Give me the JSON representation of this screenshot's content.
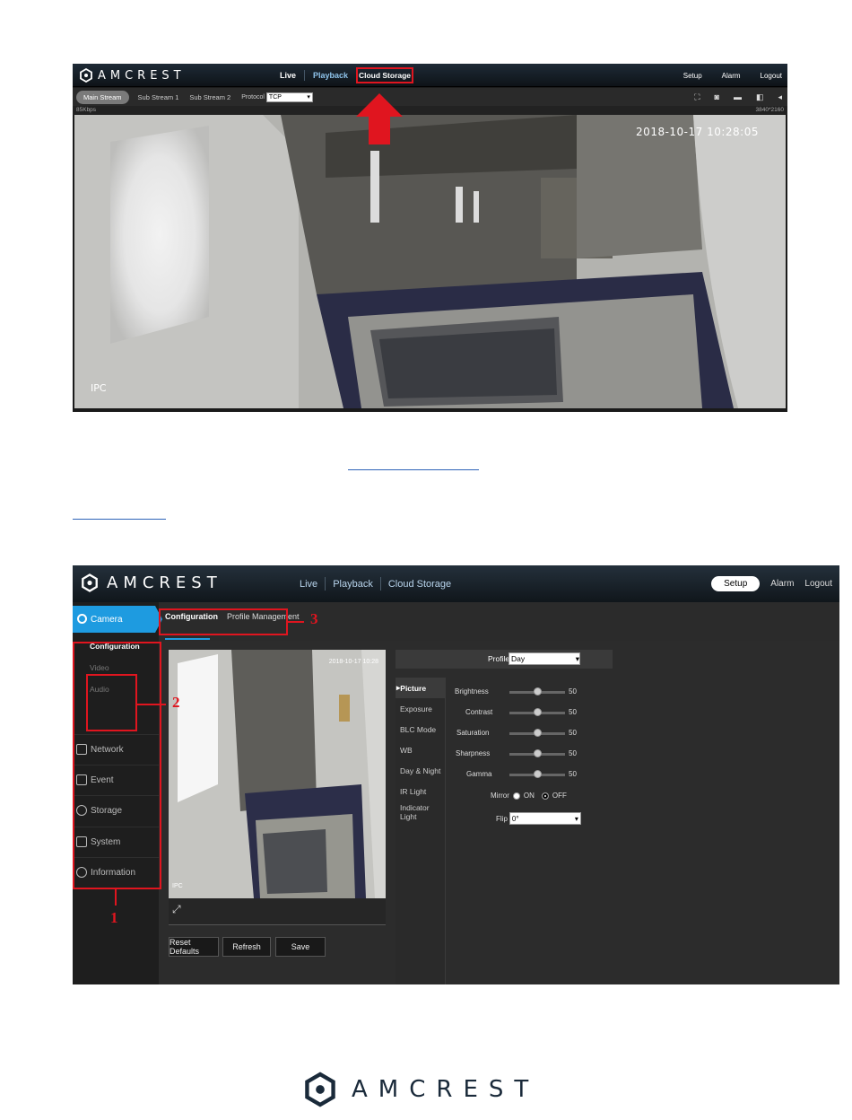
{
  "live_view": {
    "brand": "AMCREST",
    "nav": [
      "Live",
      "Playback",
      "Cloud Storage"
    ],
    "nav_right": [
      "Setup",
      "Alarm",
      "Logout"
    ],
    "streams": [
      "Main Stream",
      "Sub Stream 1",
      "Sub Stream 2"
    ],
    "protocol_label": "Protocol",
    "protocol_value": "TCP",
    "bitrate": "85Kbps",
    "resolution": "3840*2160",
    "timestamp": "2018-10-17 10:28:05",
    "overlay": "IPC"
  },
  "setup_view": {
    "brand": "AMCREST",
    "nav": [
      "Live",
      "Playback",
      "Cloud Storage"
    ],
    "setup_label": "Setup",
    "alarm_label": "Alarm",
    "logout_label": "Logout",
    "tabs": [
      "Configuration",
      "Profile Management"
    ],
    "side_menu": {
      "camera": "Camera",
      "camera_sub": [
        "Configuration",
        "Video",
        "Audio"
      ],
      "items": [
        "Network",
        "Event",
        "Storage",
        "System",
        "Information"
      ]
    },
    "video_timestamp": "2018-10-17 10:28",
    "video_overlay": "IPC",
    "buttons": [
      "Reset Defaults",
      "Refresh",
      "Save"
    ],
    "profile_label": "Profile",
    "profile_value": "Day",
    "picture_menu": [
      "Picture",
      "Exposure",
      "BLC Mode",
      "WB",
      "Day & Night",
      "IR Light",
      "Indicator Light"
    ],
    "settings": [
      {
        "name": "Brightness",
        "value": "50"
      },
      {
        "name": "Contrast",
        "value": "50"
      },
      {
        "name": "Saturation",
        "value": "50"
      },
      {
        "name": "Sharpness",
        "value": "50"
      },
      {
        "name": "Gamma",
        "value": "50"
      }
    ],
    "mirror_label": "Mirror",
    "mirror_on": "ON",
    "mirror_off": "OFF",
    "flip_label": "Flip",
    "flip_value": "0°"
  },
  "callouts": {
    "one": "1",
    "two": "2",
    "three": "3"
  },
  "footer_brand": "AMCREST",
  "colors": {
    "accent": "#1e9be0",
    "callout": "#e0151f",
    "link": "#2d63b8"
  }
}
